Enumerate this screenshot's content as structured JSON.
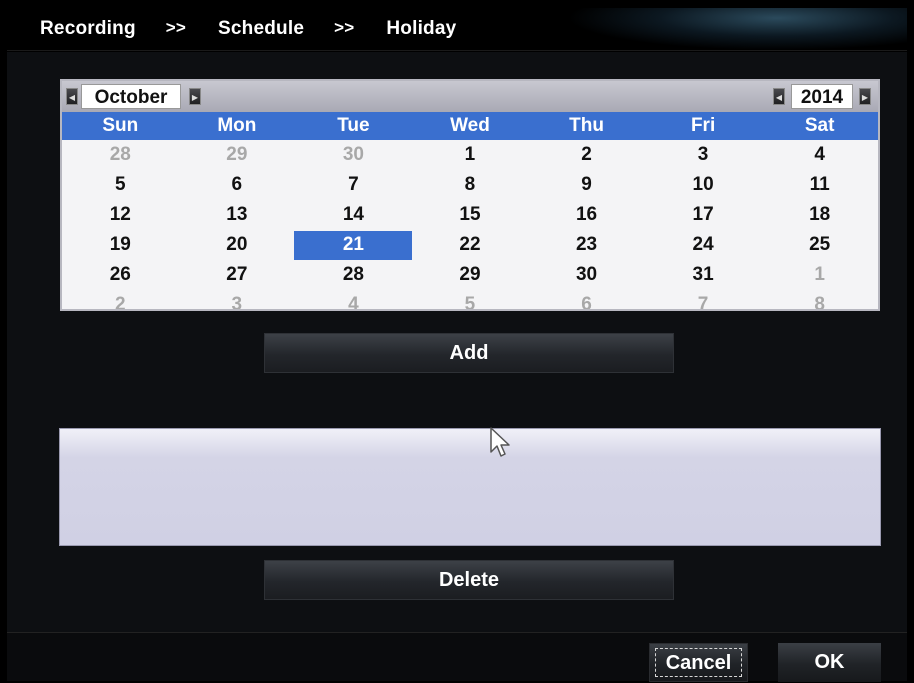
{
  "breadcrumb": {
    "items": [
      "Recording",
      "Schedule",
      "Holiday"
    ],
    "separator": ">>"
  },
  "calendar": {
    "month": "October",
    "year": "2014",
    "prev_month_icon": "left-arrow",
    "next_month_icon": "right-arrow",
    "prev_year_icon": "left-arrow",
    "next_year_icon": "right-arrow",
    "weekdays": [
      "Sun",
      "Mon",
      "Tue",
      "Wed",
      "Thu",
      "Fri",
      "Sat"
    ],
    "weeks": [
      [
        {
          "d": "28",
          "muted": true
        },
        {
          "d": "29",
          "muted": true
        },
        {
          "d": "30",
          "muted": true
        },
        {
          "d": "1"
        },
        {
          "d": "2"
        },
        {
          "d": "3"
        },
        {
          "d": "4"
        }
      ],
      [
        {
          "d": "5"
        },
        {
          "d": "6"
        },
        {
          "d": "7"
        },
        {
          "d": "8"
        },
        {
          "d": "9"
        },
        {
          "d": "10"
        },
        {
          "d": "11"
        }
      ],
      [
        {
          "d": "12"
        },
        {
          "d": "13"
        },
        {
          "d": "14"
        },
        {
          "d": "15"
        },
        {
          "d": "16"
        },
        {
          "d": "17"
        },
        {
          "d": "18"
        }
      ],
      [
        {
          "d": "19"
        },
        {
          "d": "20"
        },
        {
          "d": "21",
          "selected": true
        },
        {
          "d": "22"
        },
        {
          "d": "23"
        },
        {
          "d": "24"
        },
        {
          "d": "25"
        }
      ],
      [
        {
          "d": "26"
        },
        {
          "d": "27"
        },
        {
          "d": "28"
        },
        {
          "d": "29"
        },
        {
          "d": "30"
        },
        {
          "d": "31"
        },
        {
          "d": "1",
          "muted": true
        }
      ],
      [
        {
          "d": "2",
          "muted": true
        },
        {
          "d": "3",
          "muted": true
        },
        {
          "d": "4",
          "muted": true
        },
        {
          "d": "5",
          "muted": true
        },
        {
          "d": "6",
          "muted": true
        },
        {
          "d": "7",
          "muted": true
        },
        {
          "d": "8",
          "muted": true
        }
      ]
    ],
    "selected_color": "#3a6fcf"
  },
  "buttons": {
    "add": "Add",
    "delete": "Delete",
    "cancel": "Cancel",
    "ok": "OK"
  },
  "holiday_list": {
    "items": []
  },
  "colors": {
    "accent": "#3a6fcf",
    "background": "#0d0f12"
  }
}
